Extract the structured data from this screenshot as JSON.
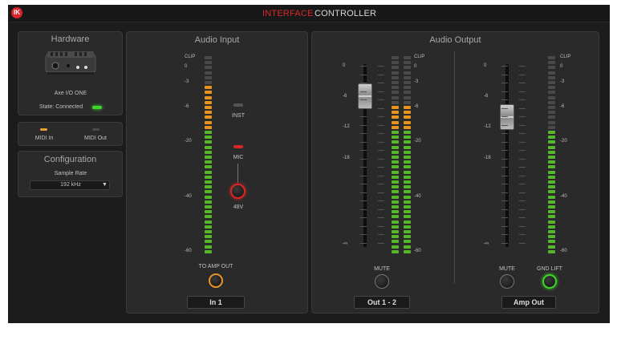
{
  "app": {
    "logo_text": "IK",
    "tabs": [
      {
        "label": "INTERFACE",
        "active": true
      },
      {
        "label": "CONTROLLER",
        "active": false
      }
    ],
    "accent_color": "#d82a2a"
  },
  "hardware": {
    "title": "Hardware",
    "device_name": "Axe I/O ONE",
    "state_label": "State: Connected",
    "state_led_color": "#3fd42a"
  },
  "midi": {
    "in_label": "MIDI In",
    "out_label": "MIDI Out"
  },
  "configuration": {
    "title": "Configuration",
    "sample_rate_label": "Sample Rate",
    "sample_rate_value": "192 kHz"
  },
  "audio_input": {
    "title": "Audio Input",
    "meter_scale": [
      "CLIP",
      "0",
      "-3",
      "-6",
      "-20",
      "-40",
      "-60"
    ],
    "inst_label": "INST",
    "mic_label": "MIC",
    "phantom_label": "48V",
    "amp_out_label": "TO AMP OUT",
    "channel_label": "In 1",
    "level_fraction": 0.85
  },
  "audio_output": {
    "title": "Audio Output",
    "main": {
      "fader_scale": [
        "0",
        "-6",
        "-12",
        "-18",
        "-∞"
      ],
      "meter_scale": [
        "CLIP",
        "0",
        "-3",
        "-6",
        "-20",
        "-40",
        "-60"
      ],
      "mute_label": "MUTE",
      "channel_label": "Out 1 - 2",
      "fader_db": -6,
      "level_fraction": 0.75
    },
    "amp": {
      "fader_scale": [
        "0",
        "-6",
        "-12",
        "-18",
        "-∞"
      ],
      "meter_scale": [
        "CLIP",
        "0",
        "-3",
        "-6",
        "-20",
        "-40",
        "-60"
      ],
      "mute_label": "MUTE",
      "gnd_lift_label": "GND LIFT",
      "channel_label": "Amp Out",
      "fader_db": -10,
      "level_fraction": 0.62
    }
  }
}
